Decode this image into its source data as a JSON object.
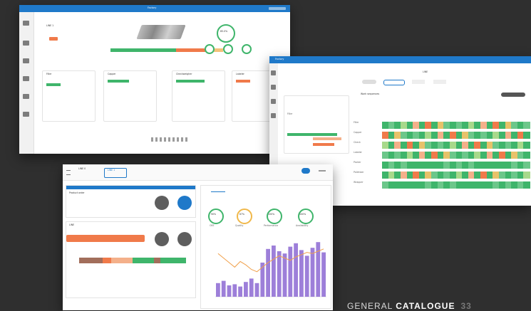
{
  "screen1": {
    "app_title": "Factory",
    "header_button": "LINE 1",
    "gauges": [
      "85.0%",
      "92%",
      "88%",
      "95%"
    ],
    "stations": [
      {
        "title": "Filler",
        "status_color": "#3fb56b"
      },
      {
        "title": "Capper",
        "status_color": "#3fb56b"
      },
      {
        "title": "Checkweigher",
        "status_color": "#3fb56b"
      },
      {
        "title": "Labeler",
        "status_color": "#f07a4a"
      }
    ]
  },
  "screen2": {
    "app_title": "Factory",
    "breadcrumb": "LINE",
    "section_title": "Work sequences",
    "row_labels": [
      "Filler",
      "Capper",
      "Check",
      "Labeler",
      "Packer",
      "Palletizer",
      "Wrapper"
    ],
    "left_label": "Filler"
  },
  "screen3": {
    "tab_active": "LINE 1",
    "order_panel_title": "Product order",
    "line_panel_title": "LINE",
    "gauges": [
      "90%",
      "67%",
      "100%",
      "100%"
    ],
    "gauge_labels": [
      "OEE",
      "Quality",
      "Performance",
      "Availability"
    ],
    "chart_series": [
      12,
      14,
      10,
      11,
      9,
      13,
      16,
      12,
      30,
      42,
      45,
      40,
      38,
      44,
      47,
      41,
      36,
      43,
      48,
      39
    ],
    "line_series": [
      38,
      34,
      30,
      26,
      31,
      28,
      24,
      22,
      26,
      30,
      33,
      36,
      34,
      32,
      35,
      37,
      39,
      38,
      40,
      42
    ]
  },
  "catalog": {
    "text_prefix": "GENERAL ",
    "text_bold": "CATALOGUE",
    "page_number": "33"
  },
  "colors": {
    "accent_blue": "#1f79c9",
    "good_green": "#3fb56b",
    "warn_orange": "#f07a4a",
    "bar_purple": "#9d7fd9"
  }
}
